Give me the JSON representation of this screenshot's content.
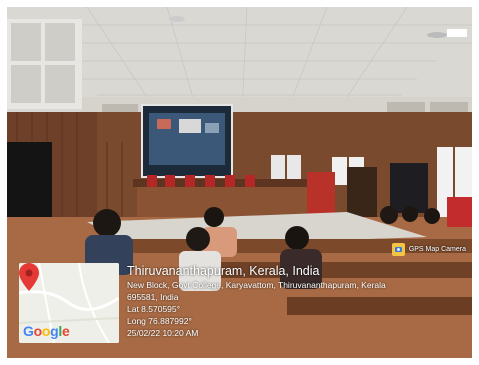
{
  "photo": {
    "description_tag": "seminar-hall-photo"
  },
  "gps_badge": {
    "label": "GPS Map Camera",
    "icon": "camera-icon"
  },
  "location": {
    "title": "Thiruvananthapuram, Kerala, India",
    "address_line1": "New Block, Govt College, Karyavattom, Thiruvananthapuram, Kerala",
    "address_line2": "695581, India",
    "lat": "Lat 8.570595°",
    "long": "Long 76.887992°",
    "datetime": "25/02/22 10:20 AM"
  },
  "map": {
    "logo_text": "Google",
    "pin_color": "#e53935"
  }
}
